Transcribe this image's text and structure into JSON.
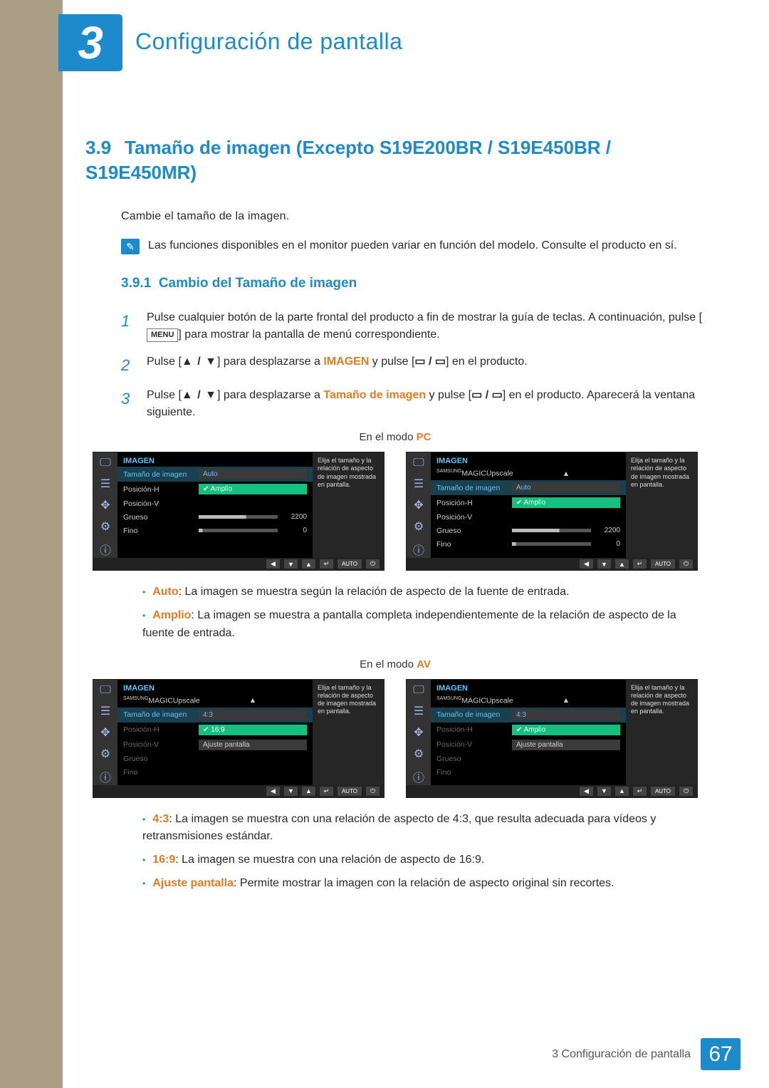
{
  "chapter": {
    "number": "3",
    "title": "Configuración de pantalla"
  },
  "section": {
    "number": "3.9",
    "title": "Tamaño de imagen (Excepto S19E200BR / S19E450BR / S19E450MR)",
    "intro": "Cambie el tamaño de la imagen.",
    "note": "Las funciones disponibles en el monitor pueden variar en función del modelo. Consulte el producto en sí."
  },
  "subsection": {
    "number": "3.9.1",
    "title": "Cambio del Tamaño de imagen"
  },
  "steps": {
    "s1_a": "Pulse cualquier botón de la parte frontal del producto a fin de mostrar la guía de teclas. A continuación, pulse [",
    "s1_b": "] para mostrar la pantalla de menú correspondiente.",
    "menu_key": "MENU",
    "s2_a": "Pulse [",
    "arrows": "▲ / ▼",
    "s2_b": "] para desplazarse a ",
    "s2_target": "IMAGEN",
    "s2_c": " y pulse [",
    "rect_icons": "▭ / ▭",
    "s2_d": "] en el producto.",
    "s3_a": "Pulse [",
    "s3_b": "] para desplazarse a ",
    "s3_target": "Tamaño de imagen",
    "s3_c": " y pulse [",
    "s3_d": "] en el producto. Aparecerá la ventana siguiente."
  },
  "mode_pc_label_a": "En el modo ",
  "mode_pc_label_b": "PC",
  "mode_av_label_a": "En el modo ",
  "mode_av_label_b": "AV",
  "osd_common": {
    "title": "IMAGEN",
    "tip": "Elija el tamaño y la relación de aspecto de imagen mostrada en pantalla.",
    "footer": {
      "left": "◀",
      "down": "▼",
      "up": "▲",
      "enter": "↵",
      "auto": "AUTO",
      "power": "⏻"
    }
  },
  "osd_pc_a": {
    "items": [
      "Tamaño de imagen",
      "Posición-H",
      "Posición-V",
      "Grueso",
      "Fino"
    ],
    "auto": "Auto",
    "amplio": "Amplio",
    "grueso_val": "2200",
    "fino_val": "0"
  },
  "osd_pc_b": {
    "top": "MAGICUpscale",
    "brand": "SAMSUNG",
    "items": [
      "Tamaño de imagen",
      "Posición-H",
      "Posición-V",
      "Grueso",
      "Fino"
    ],
    "auto": "Auto",
    "amplio": "Amplio",
    "grueso_val": "2200",
    "fino_val": "0"
  },
  "bullets_pc": {
    "b1_k": "Auto",
    "b1_t": ": La imagen se muestra según la relación de aspecto de la fuente de entrada.",
    "b2_k": "Amplio",
    "b2_t": ": La imagen se muestra a pantalla completa independientemente de la relación de aspecto de la fuente de entrada."
  },
  "osd_av": {
    "top": "MAGICUpscale",
    "brand": "SAMSUNG",
    "items": [
      "Tamaño de imagen",
      "Posición-H",
      "Posición-V",
      "Grueso",
      "Fino"
    ],
    "v43": "4:3",
    "v169": "16:9",
    "amplio": "Amplio",
    "ajuste": "Ajuste pantalla"
  },
  "bullets_av": {
    "b1_k": "4:3",
    "b1_t": ": La imagen se muestra con una relación de aspecto de 4:3, que resulta adecuada para vídeos y retransmisiones estándar.",
    "b2_k": "16:9",
    "b2_t": ": La imagen se muestra con una relación de aspecto de 16:9.",
    "b3_k": "Ajuste pantalla",
    "b3_t": ": Permite mostrar la imagen con la relación de aspecto original sin recortes."
  },
  "footer": {
    "text": "3 Configuración de pantalla",
    "page": "67"
  }
}
